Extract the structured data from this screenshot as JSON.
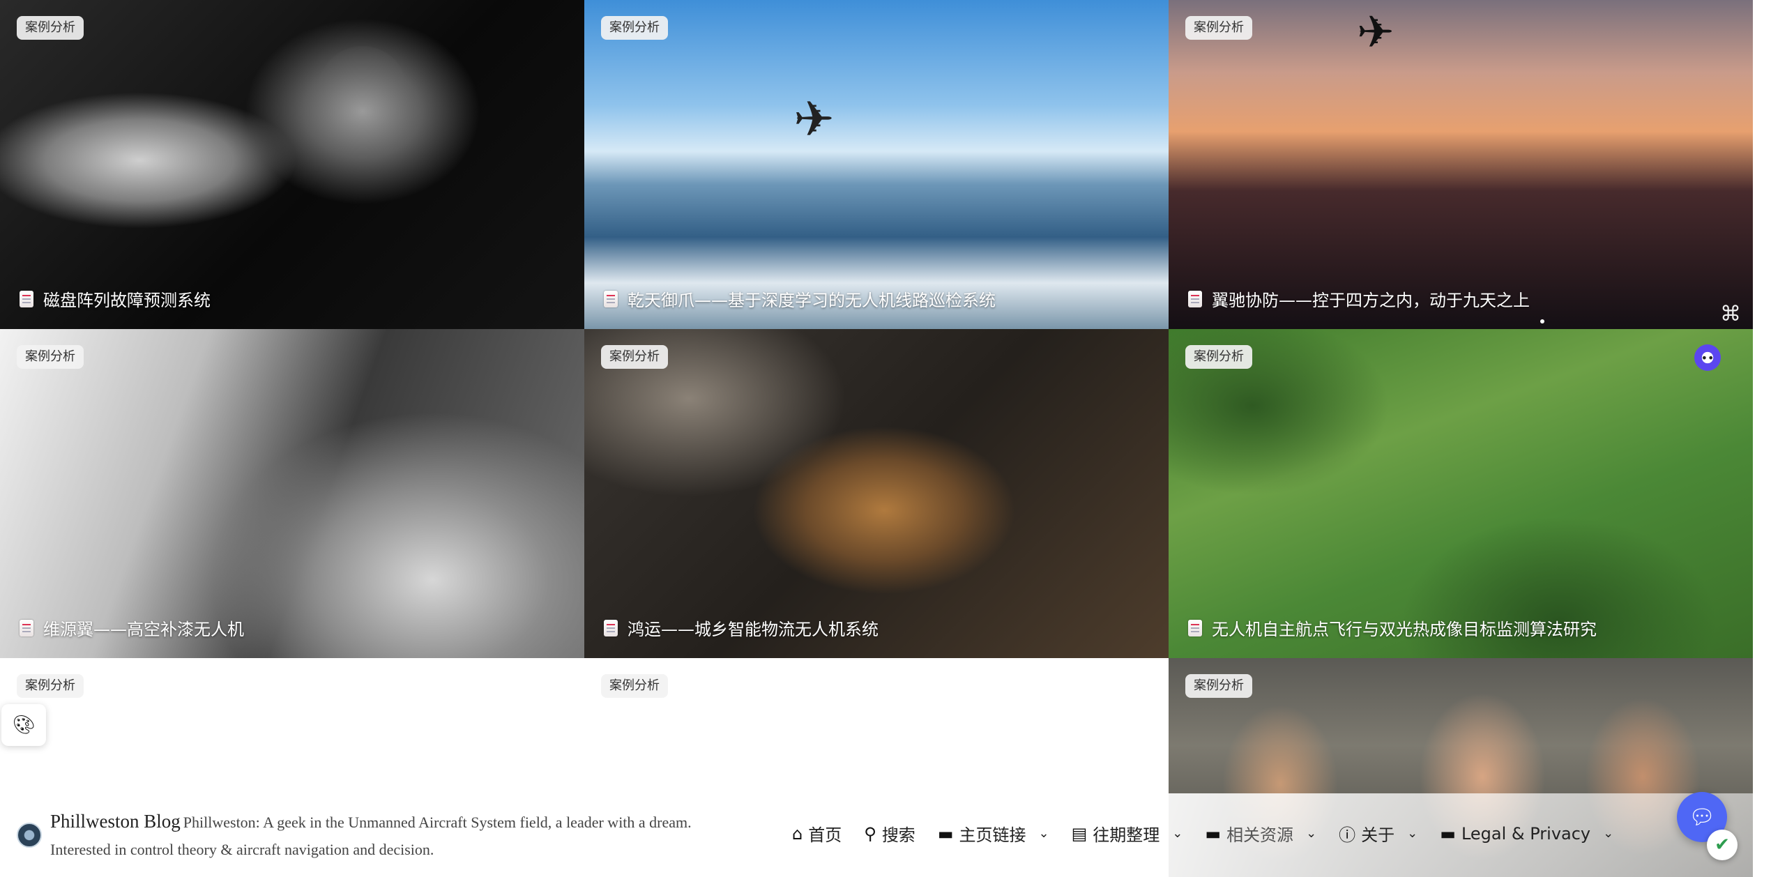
{
  "cards": [
    {
      "tag": "案例分析",
      "title": "磁盘阵列故障预测系统"
    },
    {
      "tag": "案例分析",
      "title": "乾天御爪——基于深度学习的无人机线路巡检系统"
    },
    {
      "tag": "案例分析",
      "title": "翼驰协防——控于四方之内，动于九天之上"
    },
    {
      "tag": "案例分析",
      "title": "维源翼——高空补漆无人机"
    },
    {
      "tag": "案例分析",
      "title": "鸿运——城乡智能物流无人机系统"
    },
    {
      "tag": "案例分析",
      "title": "无人机自主航点飞行与双光热成像目标监测算法研究"
    },
    {
      "tag": "案例分析",
      "title": ""
    },
    {
      "tag": "案例分析",
      "title": ""
    },
    {
      "tag": "案例分析",
      "title": ""
    }
  ],
  "footer": {
    "blog_name": "Phillweston Blog",
    "blog_desc": "Phillweston: A geek in the Unmanned Aircraft System field, a leader with a dream. Interested in control theory & aircraft navigation and decision."
  },
  "menu": [
    {
      "label": "首页",
      "icon": "home-icon",
      "glyph": "⌂",
      "dropdown": false
    },
    {
      "label": "搜索",
      "icon": "search-icon",
      "glyph": "🔍︎",
      "dropdown": false
    },
    {
      "label": "主页链接",
      "icon": "folder-icon",
      "glyph": "▬",
      "dropdown": true
    },
    {
      "label": "往期整理",
      "icon": "archive-icon",
      "glyph": "▤",
      "dropdown": true
    },
    {
      "label": "相关资源",
      "icon": "folder-icon",
      "glyph": "▬",
      "dropdown": true
    },
    {
      "label": "关于",
      "icon": "info-icon",
      "glyph": "ⓘ",
      "dropdown": true
    },
    {
      "label": "Legal & Privacy",
      "icon": "folder-icon",
      "glyph": "▬",
      "dropdown": true
    }
  ],
  "colors": {
    "chat_bubble": "#4f67f5",
    "shield": "#2e9d4f",
    "tag_bg": "#f2f2f2"
  }
}
